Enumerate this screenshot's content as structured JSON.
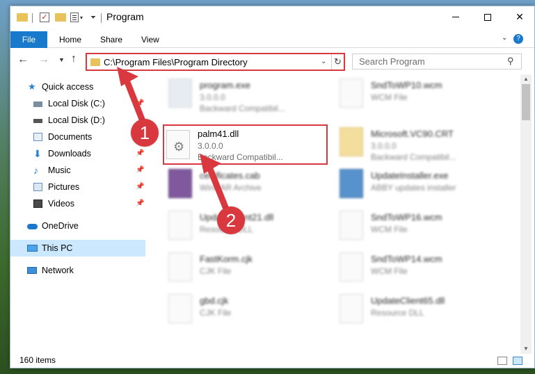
{
  "window": {
    "title": "Program"
  },
  "ribbon": {
    "file": "File",
    "home": "Home",
    "share": "Share",
    "view": "View"
  },
  "address": {
    "path": "C:\\Program Files\\Program Directory"
  },
  "search": {
    "placeholder": "Search Program"
  },
  "sidebar": {
    "items": [
      {
        "label": "Quick access"
      },
      {
        "label": "Local Disk (C:)"
      },
      {
        "label": "Local Disk (D:)"
      },
      {
        "label": "Documents"
      },
      {
        "label": "Downloads"
      },
      {
        "label": "Music"
      },
      {
        "label": "Pictures"
      },
      {
        "label": "Videos"
      },
      {
        "label": "OneDrive"
      },
      {
        "label": "This PC"
      },
      {
        "label": "Network"
      }
    ]
  },
  "files": [
    {
      "name": "program.exe",
      "line2": "3.0.0.0",
      "line3": "Backward Compatibil..."
    },
    {
      "name": "SndToWP10.wcm",
      "line2": "WCM File",
      "line3": ""
    },
    {
      "name": "palm41.dll",
      "line2": "3.0.0.0",
      "line3": "Backward Compatibil..."
    },
    {
      "name": "Microsoft.VC90.CRT",
      "line2": "3.0.0.0",
      "line3": "Backward Compatibil..."
    },
    {
      "name": "certificates.cab",
      "line2": "WinRAR Archive",
      "line3": ""
    },
    {
      "name": "UpdateInstaller.exe",
      "line2": "ABBY updates installer",
      "line3": ""
    },
    {
      "name": "UpdateClient21.dll",
      "line2": "Resource DLL",
      "line3": ""
    },
    {
      "name": "SndToWP16.wcm",
      "line2": "WCM File",
      "line3": ""
    },
    {
      "name": "FastKorm.cjk",
      "line2": "CJK File",
      "line3": ""
    },
    {
      "name": "SndToWP14.wcm",
      "line2": "WCM File",
      "line3": ""
    },
    {
      "name": "gbd.cjk",
      "line2": "CJK File",
      "line3": ""
    },
    {
      "name": "UpdateClient65.dll",
      "line2": "Resource DLL",
      "line3": ""
    }
  ],
  "status": {
    "count": "160 items"
  },
  "callouts": {
    "one": "1",
    "two": "2"
  },
  "colors": {
    "accent": "#1979ca",
    "highlight": "#d9383f",
    "selected": "#cce8ff"
  }
}
